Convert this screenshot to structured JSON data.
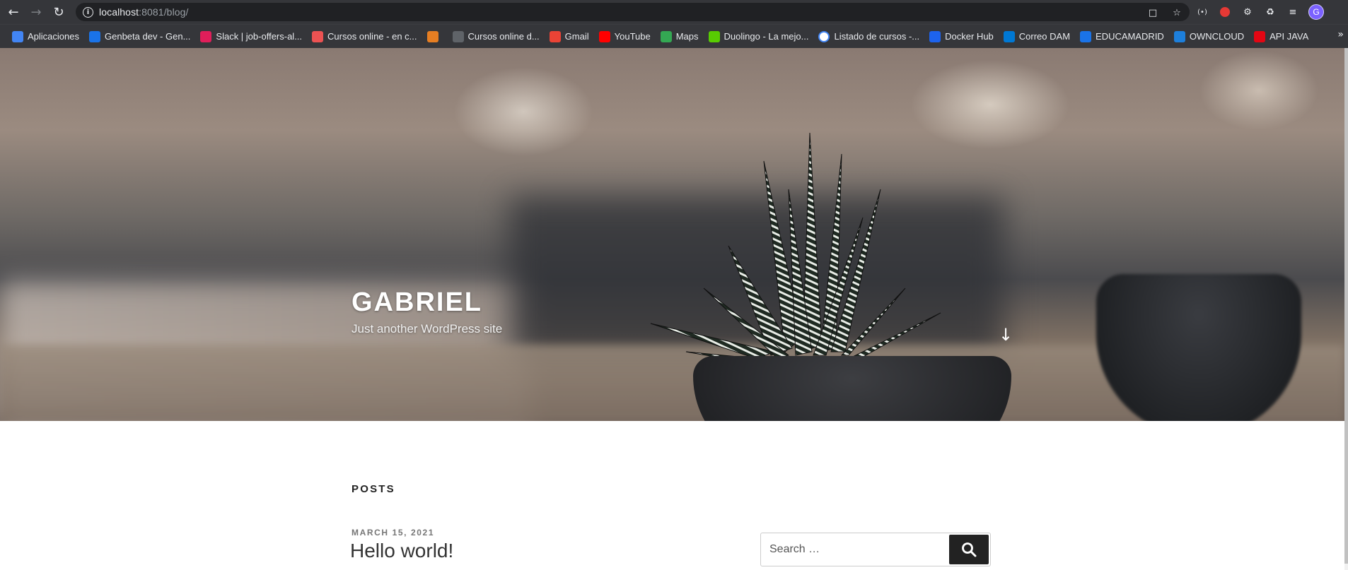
{
  "browser": {
    "url_host": "localhost",
    "url_rest": ":8081/blog/",
    "back_icon": "arrow-left-icon",
    "forward_icon": "arrow-right-icon",
    "reload_icon": "reload-icon",
    "profile_initial": "G",
    "bookmarks": [
      {
        "label": "Aplicaciones",
        "icon": "apps-grid-icon",
        "color": "#4285f4"
      },
      {
        "label": "Genbeta dev - Gen...",
        "icon": "genbeta-icon",
        "color": "#1a73e8"
      },
      {
        "label": "Slack | job-offers-al...",
        "icon": "slack-icon",
        "color": "#e01e5a"
      },
      {
        "label": "Cursos online - en c...",
        "icon": "udemy-icon",
        "color": "#ec5252"
      },
      {
        "label": "",
        "icon": "cat-icon",
        "color": "#e67e22"
      },
      {
        "label": "Cursos online d...",
        "icon": "laptop-icon",
        "color": "#5f6368"
      },
      {
        "label": "Gmail",
        "icon": "gmail-icon",
        "color": "#ea4335"
      },
      {
        "label": "YouTube",
        "icon": "youtube-icon",
        "color": "#ff0000"
      },
      {
        "label": "Maps",
        "icon": "maps-icon",
        "color": "#34a853"
      },
      {
        "label": "Duolingo - La mejo...",
        "icon": "duolingo-icon",
        "color": "#58cc02"
      },
      {
        "label": "Listado de cursos -...",
        "icon": "google-icon",
        "color": "#ffffff"
      },
      {
        "label": "Docker Hub",
        "icon": "docker-icon",
        "color": "#1d63ed"
      },
      {
        "label": "Correo DAM",
        "icon": "mail-icon",
        "color": "#0078d4"
      },
      {
        "label": "EDUCAMADRID",
        "icon": "graduation-cap-icon",
        "color": "#1a73e8"
      },
      {
        "label": "OWNCLOUD",
        "icon": "cloud-icon",
        "color": "#1d7fdb"
      },
      {
        "label": "API JAVA",
        "icon": "oracle-icon",
        "color": "#e30613"
      }
    ]
  },
  "site": {
    "title": "GABRIEL",
    "tagline": "Just another WordPress site"
  },
  "main": {
    "section_heading": "POSTS",
    "post": {
      "date": "MARCH 15, 2021",
      "title": "Hello world!"
    }
  },
  "search": {
    "placeholder": "Search …"
  }
}
